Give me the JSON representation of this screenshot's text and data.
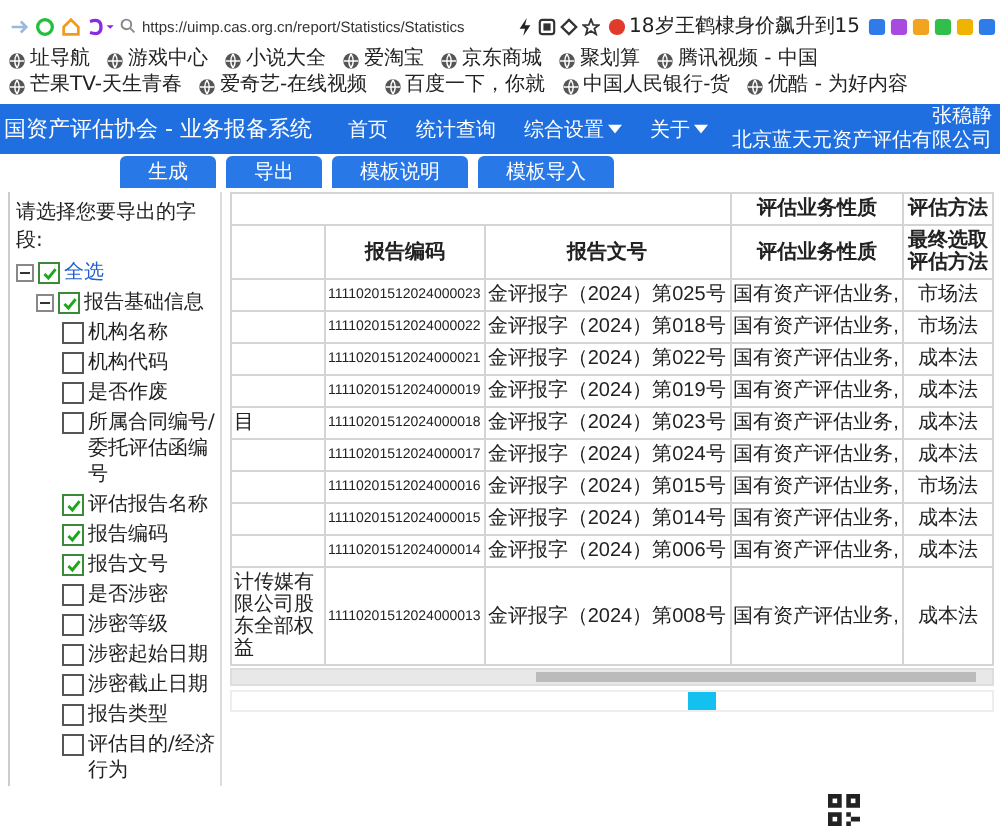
{
  "browser": {
    "url": "https://uimp.cas.org.cn/report/Statistics/Statistics",
    "news": "18岁王鹤棣身价飙升到15",
    "bookmarks": [
      "址导航",
      "游戏中心",
      "小说大全",
      "爱淘宝",
      "京东商城",
      "聚划算",
      "腾讯视频 - 中国",
      "芒果TV-天生青春",
      "爱奇艺-在线视频",
      "百度一下，你就",
      "中国人民银行-货",
      "优酷 - 为好内容"
    ]
  },
  "header": {
    "title": "国资产评估协会 - 业务报备系统",
    "nav": [
      {
        "label": "首页",
        "dropdown": false
      },
      {
        "label": "统计查询",
        "dropdown": false
      },
      {
        "label": "综合设置",
        "dropdown": true
      },
      {
        "label": "关于",
        "dropdown": true
      }
    ],
    "user": {
      "name": "张稳静",
      "org": "北京蓝天元资产评估有限公司"
    }
  },
  "tabs": [
    "生成",
    "导出",
    "模板说明",
    "模板导入"
  ],
  "field_picker": {
    "title": "请选择您要导出的字段:",
    "tree": [
      {
        "label": "全选",
        "kind": "link",
        "checked": true,
        "expanded": true,
        "children": [
          {
            "label": "报告基础信息",
            "kind": "group",
            "checked": true,
            "expanded": true,
            "children": [
              {
                "label": "机构名称",
                "kind": "field",
                "checked": false
              },
              {
                "label": "机构代码",
                "kind": "field",
                "checked": false
              },
              {
                "label": "是否作废",
                "kind": "field",
                "checked": false
              },
              {
                "label": "所属合同编号/委托评估函编号",
                "kind": "field",
                "checked": false
              },
              {
                "label": "评估报告名称",
                "kind": "field",
                "checked": true
              },
              {
                "label": "报告编码",
                "kind": "field",
                "checked": true
              },
              {
                "label": "报告文号",
                "kind": "field",
                "checked": true
              },
              {
                "label": "是否涉密",
                "kind": "field",
                "checked": false
              },
              {
                "label": "涉密等级",
                "kind": "field",
                "checked": false
              },
              {
                "label": "涉密起始日期",
                "kind": "field",
                "checked": false
              },
              {
                "label": "涉密截止日期",
                "kind": "field",
                "checked": false
              },
              {
                "label": "报告类型",
                "kind": "field",
                "checked": false
              },
              {
                "label": "评估目的/经济行为",
                "kind": "field",
                "checked": false
              }
            ]
          }
        ]
      }
    ]
  },
  "table": {
    "group_headers": [
      "评估业务性质",
      "评估方法"
    ],
    "columns": [
      "报告编码",
      "报告文号",
      "评估业务性质",
      "最终选取评估方法"
    ],
    "rows": [
      {
        "report_code": "11110201512024000023",
        "report_no": "金评报字（2024）第025号",
        "nature": "国有资产评估业务,",
        "method": "市场法"
      },
      {
        "report_code": "11110201512024000022",
        "report_no": "金评报字（2024）第018号",
        "nature": "国有资产评估业务,",
        "method": "市场法"
      },
      {
        "report_code": "11110201512024000021",
        "report_no": "金评报字（2024）第022号",
        "nature": "国有资产评估业务,",
        "method": "成本法"
      },
      {
        "report_code": "11110201512024000019",
        "report_no": "金评报字（2024）第019号",
        "nature": "国有资产评估业务,",
        "method": "成本法"
      },
      {
        "column_1": "目",
        "report_code": "11110201512024000018",
        "report_no": "金评报字（2024）第023号",
        "nature": "国有资产评估业务,",
        "method": "成本法"
      },
      {
        "report_code": "11110201512024000017",
        "report_no": "金评报字（2024）第024号",
        "nature": "国有资产评估业务,",
        "method": "成本法"
      },
      {
        "report_code": "11110201512024000016",
        "report_no": "金评报字（2024）第015号",
        "nature": "国有资产评估业务,",
        "method": "市场法"
      },
      {
        "report_code": "11110201512024000015",
        "report_no": "金评报字（2024）第014号",
        "nature": "国有资产评估业务,",
        "method": "成本法"
      },
      {
        "report_code": "11110201512024000014",
        "report_no": "金评报字（2024）第006号",
        "nature": "国有资产评估业务,",
        "method": "成本法"
      },
      {
        "column_1": "计传媒有限公司股东全部权益",
        "report_code": "11110201512024000013",
        "report_no": "金评报字（2024）第008号",
        "nature": "国有资产评估业务,",
        "method": "成本法"
      }
    ]
  }
}
